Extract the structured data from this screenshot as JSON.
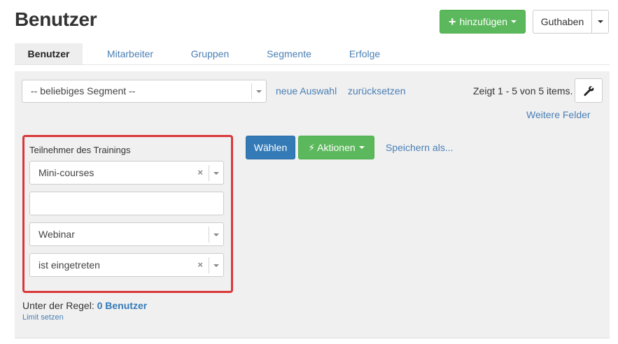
{
  "page": {
    "title": "Benutzer"
  },
  "header": {
    "add_label": "hinzufügen",
    "credit_label": "Guthaben"
  },
  "tabs": [
    {
      "label": "Benutzer",
      "active": true
    },
    {
      "label": "Mitarbeiter",
      "active": false
    },
    {
      "label": "Gruppen",
      "active": false
    },
    {
      "label": "Segmente",
      "active": false
    },
    {
      "label": "Erfolge",
      "active": false
    }
  ],
  "toolbar": {
    "segment_value": "-- beliebiges Segment --",
    "new_selection": "neue Auswahl",
    "reset": "zurücksetzen",
    "items_count": "Zeigt 1 - 5 von 5 items.",
    "more_fields": "Weitere Felder"
  },
  "filter": {
    "title": "Teilnehmer des Trainings",
    "training_value": "Mini-courses",
    "text_value": "",
    "type_value": "Webinar",
    "status_value": "ist eingetreten"
  },
  "actions": {
    "choose": "Wählen",
    "actions": "Aktionen",
    "save_as": "Speichern als..."
  },
  "rule": {
    "prefix": "Unter der Regel:",
    "count": "0 Benutzer",
    "limit_link": "Limit setzen"
  },
  "colors": {
    "primary": "#337ab7",
    "success": "#5cb85c",
    "highlight_border": "#d9383a",
    "panel_bg": "#f0f0f0"
  },
  "icons": {
    "add": "plus-icon",
    "settings": "wrench-icon",
    "actions": "bolt-icon",
    "clear": "clear-x-icon",
    "dropdown": "caret-down-icon"
  }
}
